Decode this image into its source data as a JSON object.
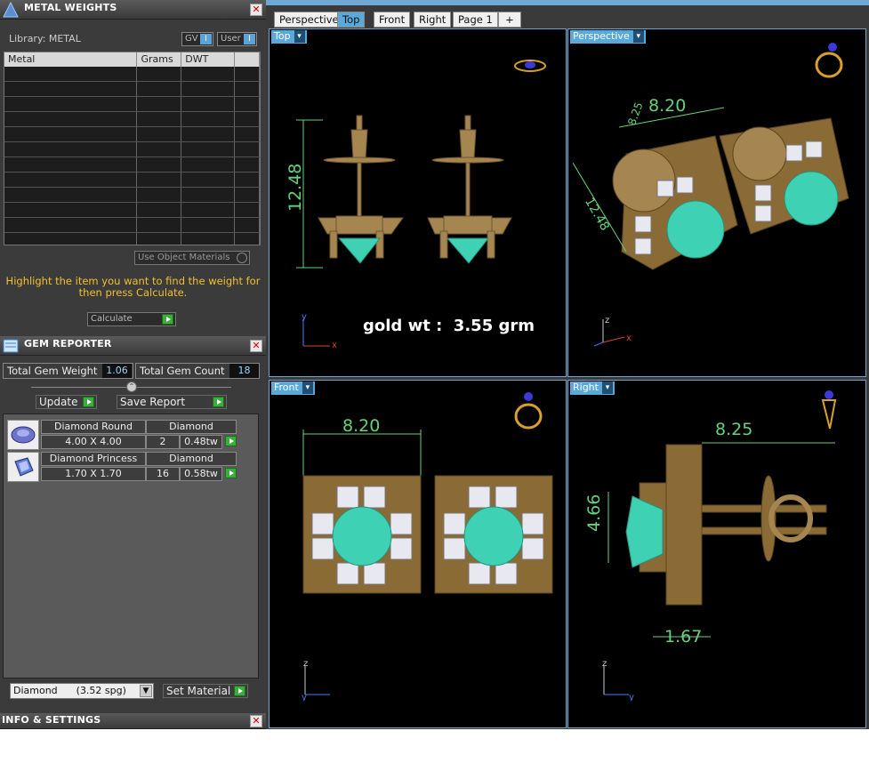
{
  "metal_panel": {
    "title": "METAL WEIGHTS",
    "library_label": "Library: METAL",
    "gv_label": "GV",
    "user_label": "User",
    "columns": [
      "Metal",
      "Grams",
      "DWT",
      ""
    ],
    "use_object_materials": "Use Object Materials",
    "hint": "Highlight the item you want to find the weight for then press Calculate.",
    "calculate_label": "Calculate"
  },
  "gem_panel": {
    "title": "GEM REPORTER",
    "total_weight_label": "Total Gem Weight",
    "total_weight_value": "1.06",
    "total_count_label": "Total Gem Count",
    "total_count_value": "18",
    "update_label": "Update",
    "save_report_label": "Save Report",
    "gems": [
      {
        "shape": "Diamond Round",
        "size": "4.00 X 4.00",
        "material": "Diamond",
        "count": "2",
        "weight": "0.48tw"
      },
      {
        "shape": "Diamond Princess",
        "size": "1.70 X 1.70",
        "material": "Diamond",
        "count": "16",
        "weight": "0.58tw"
      }
    ],
    "material_select": "Diamond      (3.52 spg)",
    "set_material_label": "Set Material"
  },
  "info_panel": {
    "title": "INFO & SETTINGS"
  },
  "viewport_tabs": [
    "Perspective",
    "Top",
    "Front",
    "Right",
    "Page 1",
    "+"
  ],
  "active_tab": "Top",
  "viewports": {
    "top": {
      "label": "Top",
      "dim_height": "12.48",
      "gold_wt": "gold wt :  3.55 grm"
    },
    "perspective": {
      "label": "Perspective",
      "dim_a": "8.20",
      "dim_b": "8.25",
      "dim_c": "12.48"
    },
    "front": {
      "label": "Front",
      "dim_width": "8.20"
    },
    "right": {
      "label": "Right",
      "dim_top": "8.25",
      "dim_left": "4.66",
      "dim_bottom": "1.67"
    }
  },
  "colors": {
    "accent": "#5aa9d8",
    "gold": "#a58550",
    "gem": "#3fd1b4",
    "dim": "#66d27a",
    "hint": "#f2c030"
  }
}
